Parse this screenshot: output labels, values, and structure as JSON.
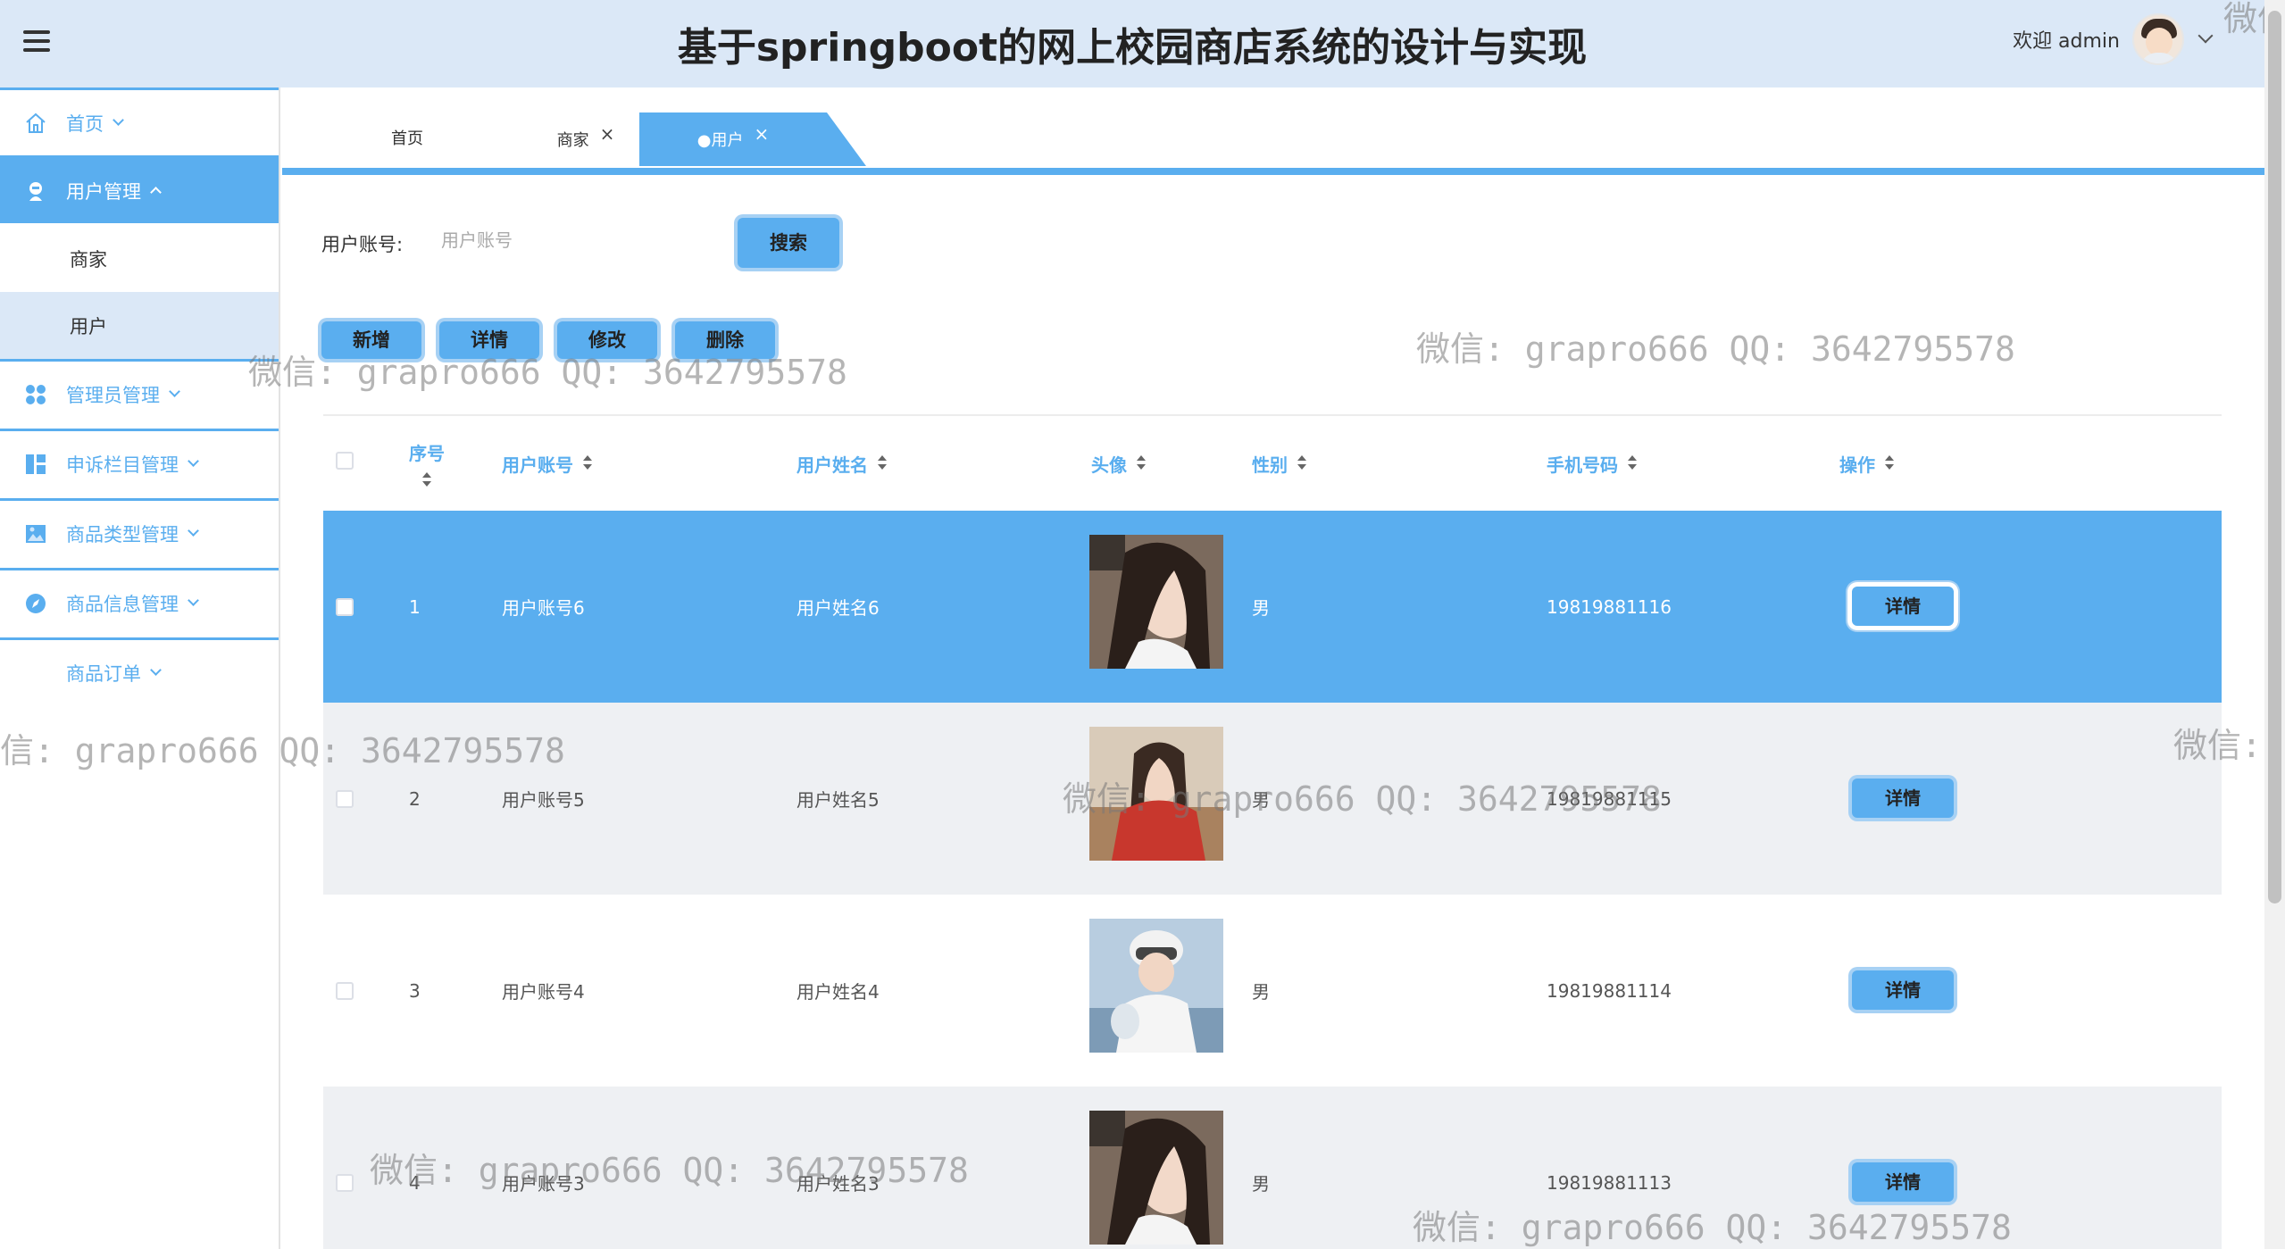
{
  "header": {
    "title": "基于springboot的网上校园商店系统的设计与实现",
    "welcome": "欢迎 admin"
  },
  "sidebar": {
    "items": [
      {
        "label": "首页",
        "icon": "home-icon"
      },
      {
        "label": "用户管理",
        "icon": "user-icon",
        "expanded": true,
        "children": [
          {
            "label": "商家"
          },
          {
            "label": "用户",
            "selected": true
          }
        ]
      },
      {
        "label": "管理员管理",
        "icon": "apps-icon"
      },
      {
        "label": "申诉栏目管理",
        "icon": "layout-icon"
      },
      {
        "label": "商品类型管理",
        "icon": "picture-icon"
      },
      {
        "label": "商品信息管理",
        "icon": "compass-icon"
      },
      {
        "label": "商品订单",
        "icon": ""
      }
    ]
  },
  "tabs": [
    {
      "label": "首页"
    },
    {
      "label": "商家",
      "close": "×"
    },
    {
      "label": "●用户",
      "close": "×",
      "active": true
    }
  ],
  "search": {
    "label": "用户账号:",
    "placeholder": "用户账号",
    "button": "搜索"
  },
  "toolbar": {
    "add": "新增",
    "detail": "详情",
    "edit": "修改",
    "delete": "删除"
  },
  "table": {
    "columns": [
      "序号",
      "用户账号",
      "用户姓名",
      "头像",
      "性别",
      "手机号码",
      "操作"
    ],
    "rows": [
      {
        "index": "1",
        "account": "用户账号6",
        "name": "用户姓名6",
        "gender": "男",
        "phone": "19819881116",
        "action": "详情"
      },
      {
        "index": "2",
        "account": "用户账号5",
        "name": "用户姓名5",
        "gender": "男",
        "phone": "19819881115",
        "action": "详情"
      },
      {
        "index": "3",
        "account": "用户账号4",
        "name": "用户姓名4",
        "gender": "男",
        "phone": "19819881114",
        "action": "详情"
      },
      {
        "index": "4",
        "account": "用户账号3",
        "name": "用户姓名3",
        "gender": "男",
        "phone": "19819881113",
        "action": "详情"
      }
    ]
  },
  "watermark": {
    "text": "微信: grapro666 QQ: 3642795578",
    "partial_left": "信: grapro666 QQ: 3642795578",
    "partial_right": "微信:",
    "partial_corner": "微信"
  },
  "colors": {
    "accent": "#5aaeef",
    "header_bg": "#dbe8f7",
    "row_alt": "#eef0f3"
  }
}
